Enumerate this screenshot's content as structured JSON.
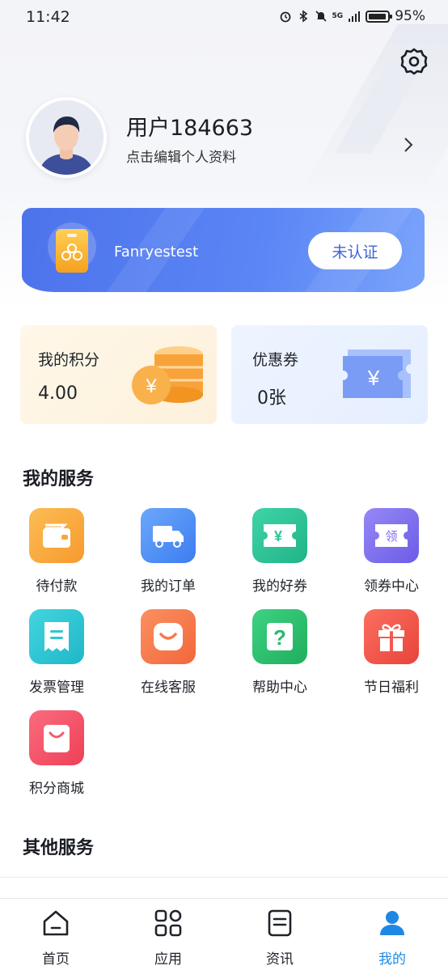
{
  "status_bar": {
    "time": "11:42",
    "network": "5G",
    "battery": "95%"
  },
  "profile": {
    "username": "用户184663",
    "edit_hint": "点击编辑个人资料"
  },
  "verify_card": {
    "name": "Fanryestest",
    "button_label": "未认证"
  },
  "points_card": {
    "title": "我的积分",
    "value": "4.00"
  },
  "coupon_card": {
    "title": "优惠券",
    "value": "0张",
    "symbol": "¥"
  },
  "coins_symbol": "¥",
  "my_services": {
    "title": "我的服务",
    "items": [
      {
        "label": "待付款",
        "icon": "wallet-icon",
        "color": "#f7a63a"
      },
      {
        "label": "我的订单",
        "icon": "truck-icon",
        "color": "#4c8ff2"
      },
      {
        "label": "我的好券",
        "icon": "coupon-icon",
        "color": "#2ec49a"
      },
      {
        "label": "领券中心",
        "icon": "coupon-center-icon",
        "color": "#7c6cf0"
      },
      {
        "label": "发票管理",
        "icon": "invoice-icon",
        "color": "#2fc6d4"
      },
      {
        "label": "在线客服",
        "icon": "service-smile-icon",
        "color": "#f7774a"
      },
      {
        "label": "帮助中心",
        "icon": "help-icon",
        "color": "#27b96b"
      },
      {
        "label": "节日福利",
        "icon": "gift-icon",
        "color": "#f25a4f"
      },
      {
        "label": "积分商城",
        "icon": "shopping-bag-icon",
        "color": "#f5576c"
      }
    ]
  },
  "icon_glyphs": {
    "coupon": "¥",
    "coupon_center": "领",
    "help": "?"
  },
  "other_services": {
    "title": "其他服务"
  },
  "tab_bar": {
    "tabs": [
      {
        "label": "首页",
        "icon": "home-icon"
      },
      {
        "label": "应用",
        "icon": "apps-grid-icon"
      },
      {
        "label": "资讯",
        "icon": "news-icon"
      },
      {
        "label": "我的",
        "icon": "profile-icon",
        "active": true
      }
    ]
  }
}
